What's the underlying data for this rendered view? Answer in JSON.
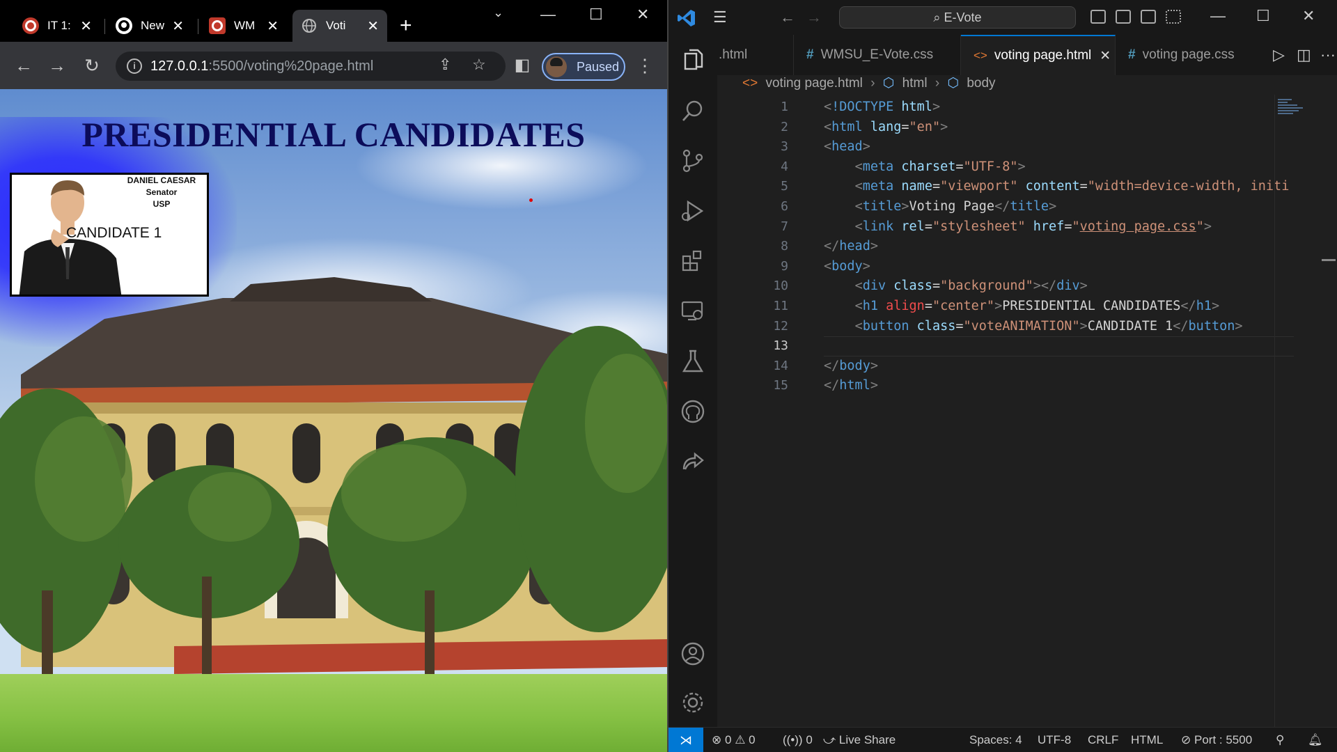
{
  "browser": {
    "tabs": [
      {
        "title": "IT 1:",
        "close": "✕"
      },
      {
        "title": "New",
        "close": "✕"
      },
      {
        "title": "WM",
        "close": "✕"
      },
      {
        "title": "Voti",
        "close": "✕",
        "active": true
      }
    ],
    "new_tab": "+",
    "address": {
      "host": "127.0.0.1",
      "path": ":5500/voting%20page.html"
    },
    "profile_label": "Paused"
  },
  "page": {
    "heading": "PRESIDENTIAL CANDIDATES",
    "candidate": {
      "name": "DANIEL CAESAR",
      "position": "Senator",
      "party": "USP",
      "button_label": "CANDIDATE 1"
    }
  },
  "vscode": {
    "command_center": "E-Vote",
    "tabs": [
      {
        "label": ".html",
        "kind": "partial"
      },
      {
        "label": "WMSU_E-Vote.css",
        "kind": "css"
      },
      {
        "label": "voting page.html",
        "kind": "html",
        "active": true
      },
      {
        "label": "voting page.css",
        "kind": "css"
      }
    ],
    "breadcrumbs": [
      "voting page.html",
      "html",
      "body"
    ],
    "line_numbers": [
      "1",
      "2",
      "3",
      "4",
      "5",
      "6",
      "7",
      "8",
      "9",
      "10",
      "11",
      "12",
      "13",
      "14",
      "15"
    ],
    "current_line": 13,
    "status": {
      "errors": "0",
      "warnings": "0",
      "ports": "0",
      "live_share": "Live Share",
      "spaces": "Spaces: 4",
      "encoding": "UTF-8",
      "eol": "CRLF",
      "language": "HTML",
      "port": "Port : 5500"
    }
  }
}
